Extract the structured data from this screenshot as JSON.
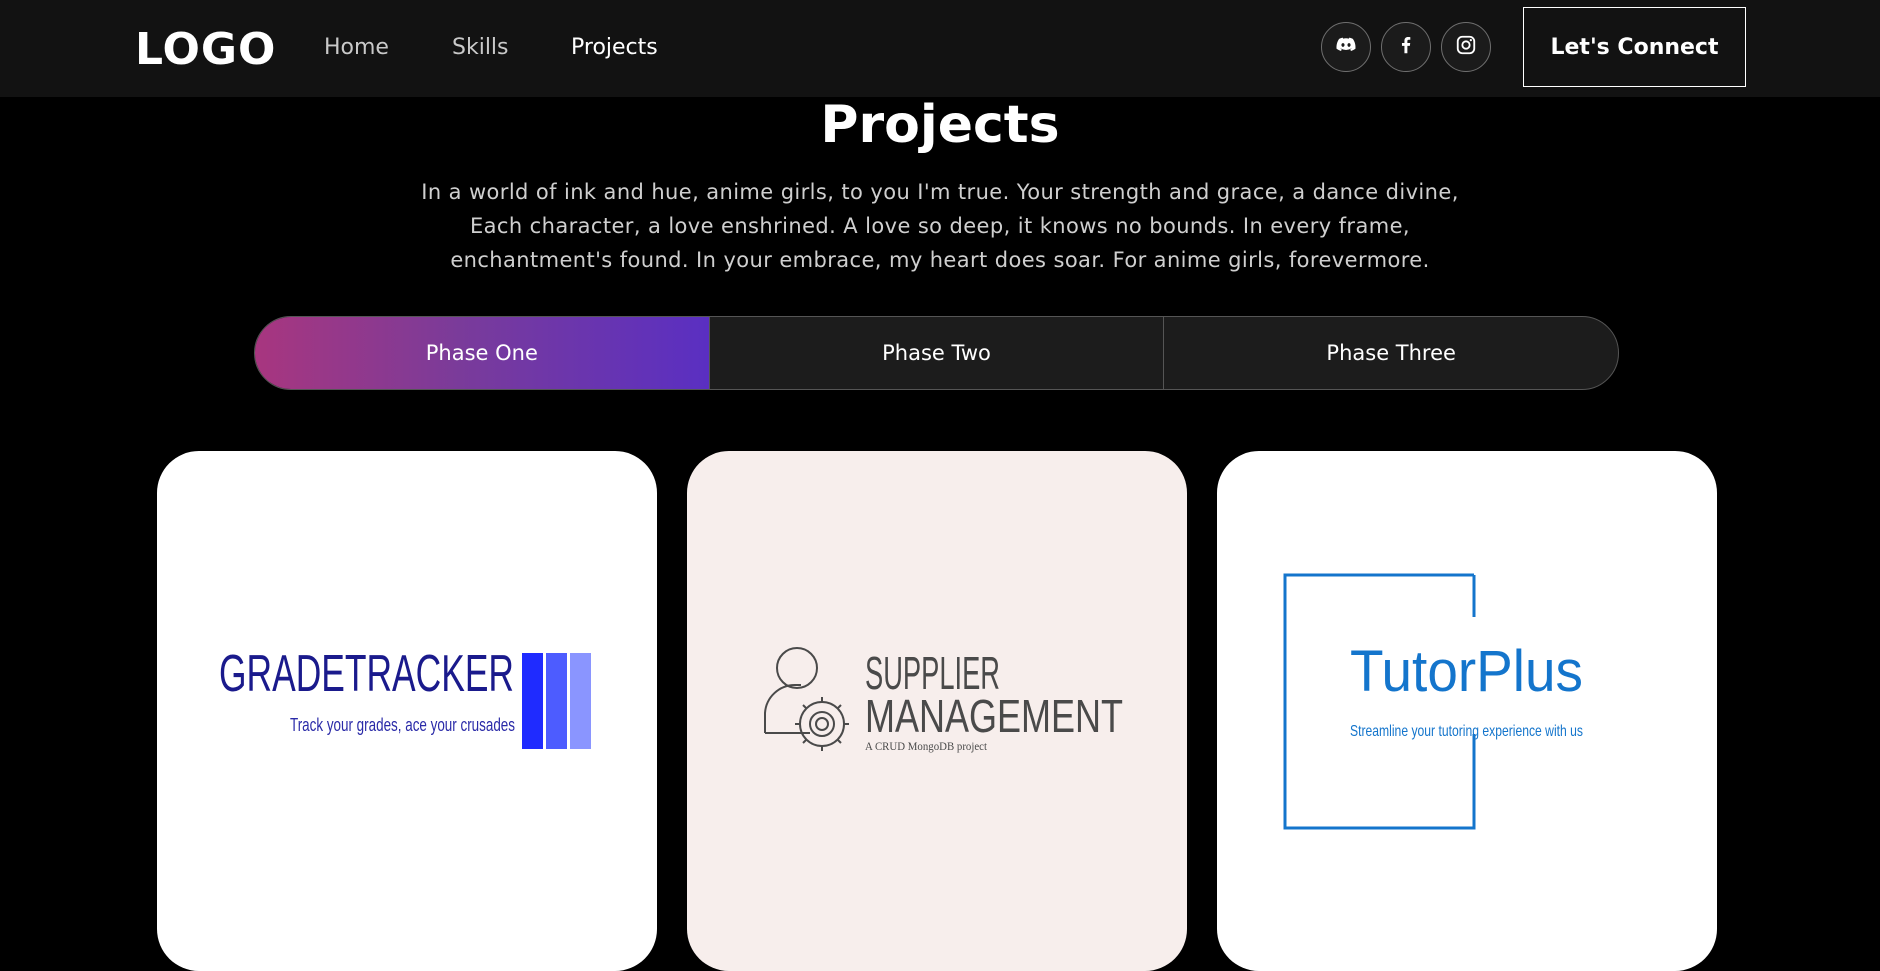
{
  "nav": {
    "logo": "LOGO",
    "links": [
      "Home",
      "Skills",
      "Projects"
    ],
    "active": "Projects",
    "social_icons": [
      "discord-icon",
      "facebook-icon",
      "instagram-icon"
    ],
    "connect_label": "Let's Connect"
  },
  "projects": {
    "title": "Projects",
    "description": "In a world of ink and hue, anime girls, to you I'm true. Your strength and grace, a dance divine, Each character, a love enshrined. A love so deep, it knows no bounds. In every frame, enchantment's found. In your embrace, my heart does soar. For anime girls, forevermore.",
    "tabs": [
      "Phase One",
      "Phase Two",
      "Phase Three"
    ],
    "active_tab": "Phase One",
    "cards": [
      {
        "name": "GRADETRACKER",
        "tagline": "Track your grades, ace your crusades",
        "bg": "#ffffff",
        "color": "#1a1a8c"
      },
      {
        "name_line1": "SUPPLIER",
        "name_line2": "MANAGEMENT",
        "tagline": "A CRUD MongoDB project",
        "bg": "#f7eeec",
        "color": "#4a4a4a"
      },
      {
        "name": "TutorPlus",
        "tagline": "Streamline your tutoring experience with us",
        "bg": "#ffffff",
        "color": "#1475cc"
      }
    ]
  },
  "colors": {
    "nav_bg": "#121212",
    "page_bg": "#000000",
    "tab_gradient_start": "#a8367f",
    "tab_gradient_end": "#5a2fc2"
  }
}
